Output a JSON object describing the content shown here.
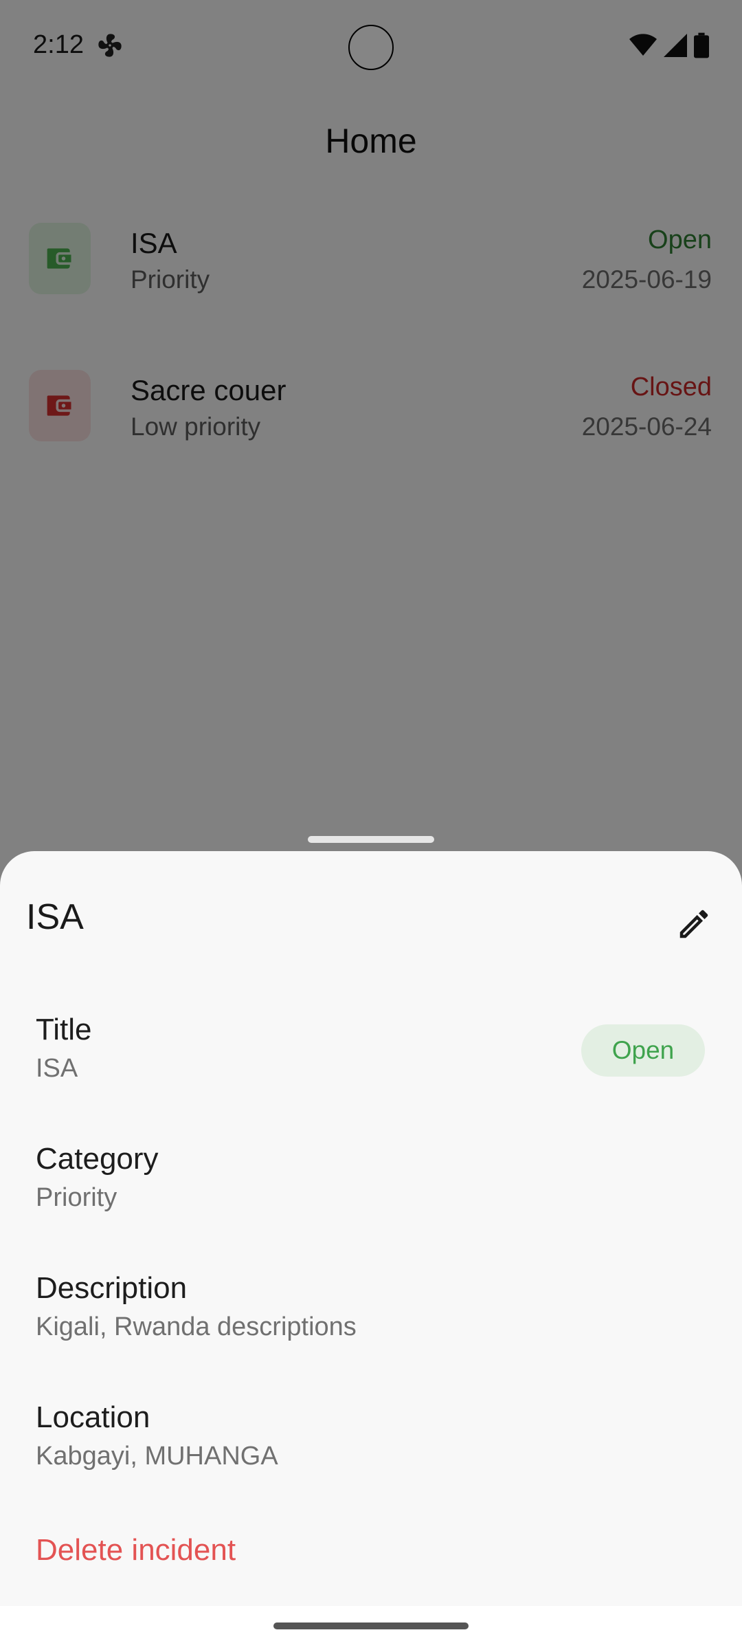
{
  "status_bar": {
    "time": "2:12"
  },
  "app": {
    "title": "Home"
  },
  "incidents": [
    {
      "title": "ISA",
      "category": "Priority",
      "status": "Open",
      "date": "2025-06-19",
      "status_color": "#2e7d32",
      "icon_tint": "#4caf50"
    },
    {
      "title": "Sacre couer",
      "category": "Low priority",
      "status": "Closed",
      "date": "2025-06-24",
      "status_color": "#c62828",
      "icon_tint": "#d32f2f"
    }
  ],
  "sheet": {
    "header_title": "ISA",
    "status_chip": "Open",
    "fields": [
      {
        "label": "Title",
        "value": "ISA"
      },
      {
        "label": "Category",
        "value": "Priority"
      },
      {
        "label": "Description",
        "value": "Kigali, Rwanda descriptions"
      },
      {
        "label": "Location",
        "value": "Kabgayi, MUHANGA"
      }
    ],
    "delete_label": "Delete incident"
  },
  "colors": {
    "accent_green": "#3fa34d",
    "danger": "#e35353"
  }
}
